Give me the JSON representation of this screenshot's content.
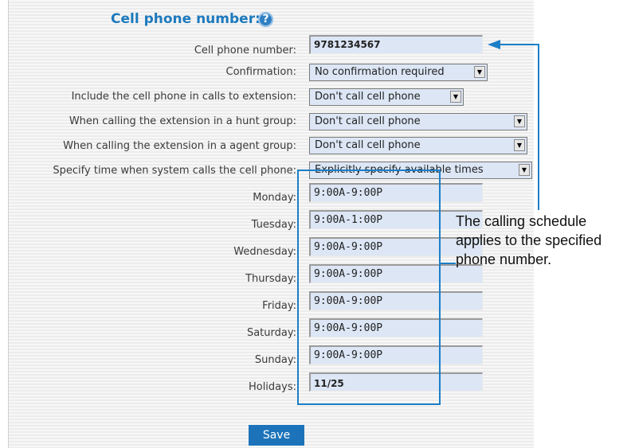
{
  "section": {
    "title": "Cell phone number:",
    "help_icon": "?"
  },
  "form": {
    "cell_phone_number": {
      "label": "Cell phone number:",
      "value": "9781234567"
    },
    "confirmation": {
      "label": "Confirmation:",
      "value": "No confirmation required"
    },
    "include_cell_phone": {
      "label": "Include the cell phone in calls to extension:",
      "value": "Don't call cell phone"
    },
    "hunt_group": {
      "label": "When calling the extension in a hunt group:",
      "value": "Don't call cell phone"
    },
    "agent_group": {
      "label": "When calling the extension in a agent group:",
      "value": "Don't call cell phone"
    },
    "time_specify": {
      "label": "Specify time when system calls the cell phone:",
      "value": "Explicitly specify available times"
    },
    "schedule": [
      {
        "label": "Monday:",
        "value": "9:00A-9:00P"
      },
      {
        "label": "Tuesday:",
        "value": "9:00A-1:00P"
      },
      {
        "label": "Wednesday:",
        "value": "9:00A-9:00P"
      },
      {
        "label": "Thursday:",
        "value": "9:00A-9:00P"
      },
      {
        "label": "Friday:",
        "value": "9:00A-9:00P"
      },
      {
        "label": "Saturday:",
        "value": "9:00A-9:00P"
      },
      {
        "label": "Sunday:",
        "value": "9:00A-9:00P"
      }
    ],
    "holidays": {
      "label": "Holidays:",
      "value": "11/25"
    },
    "save_label": "Save"
  },
  "callout": {
    "text": "The calling schedule applies to the specified phone number."
  },
  "colors": {
    "accent": "#1d79bd",
    "field_bg": "#dce6f5",
    "button_bg": "#1c73b9",
    "callout": "#1b7fc7"
  },
  "icons": {
    "help": "question-circle-icon",
    "dropdown": "triangle-down-icon"
  }
}
